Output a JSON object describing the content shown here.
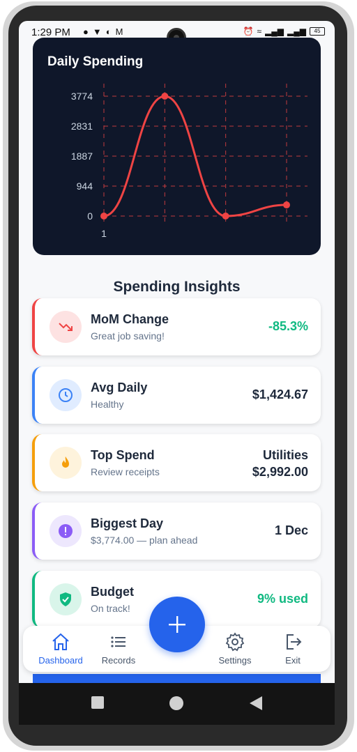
{
  "status_bar": {
    "time": "1:29 PM",
    "battery": "45"
  },
  "chart": {
    "title": "Daily Spending",
    "line_color": "#ef4444",
    "background": "#0f172a"
  },
  "chart_data": {
    "type": "line",
    "title": "Daily Spending",
    "x": [
      1,
      2,
      3,
      4
    ],
    "x_tick_labels": [
      "1"
    ],
    "values": [
      0,
      3774,
      0,
      350
    ],
    "y_ticks": [
      "3774",
      "2831",
      "1887",
      "944",
      "0"
    ],
    "ylim": [
      0,
      3774
    ],
    "grid": true,
    "grid_style": "dashed",
    "smooth": true
  },
  "insights": {
    "title": "Spending Insights",
    "cards": [
      {
        "label": "MoM Change",
        "sub": "Great job saving!",
        "value": "-85.3%",
        "accent": "#ef4444",
        "icon_bg": "#fde2e2",
        "value_color": "#10b981",
        "icon": "trending-down-icon"
      },
      {
        "label": "Avg Daily",
        "sub": "Healthy",
        "value": "$1,424.67",
        "accent": "#3b82f6",
        "icon_bg": "#e0ecff",
        "value_color": "#1e293b",
        "icon": "clock-icon"
      },
      {
        "label": "Top Spend",
        "sub": "Review receipts",
        "value_line1": "Utilities",
        "value_line2": "$2,992.00",
        "accent": "#f59e0b",
        "icon_bg": "#fef3dc",
        "value_color": "#1e293b",
        "icon": "fire-icon"
      },
      {
        "label": "Biggest Day",
        "sub": "$3,774.00 — plan ahead",
        "value": "1 Dec",
        "accent": "#8b5cf6",
        "icon_bg": "#ede7fd",
        "value_color": "#1e293b",
        "icon": "alert-icon"
      },
      {
        "label": "Budget",
        "sub": "On track!",
        "value": "9% used",
        "accent": "#10b981",
        "icon_bg": "#d9f5ea",
        "value_color": "#10b981",
        "icon": "shield-check-icon"
      }
    ]
  },
  "nav": {
    "dashboard": "Dashboard",
    "records": "Records",
    "settings": "Settings",
    "exit": "Exit",
    "active_color": "#2563eb"
  }
}
